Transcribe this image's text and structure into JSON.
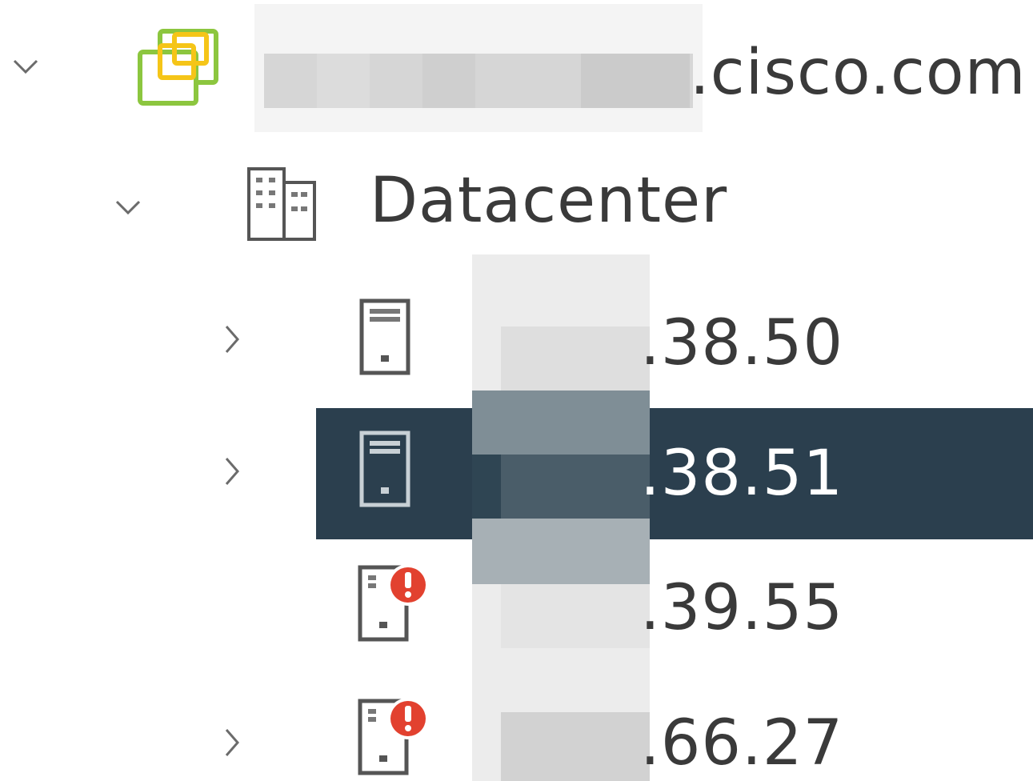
{
  "tree": {
    "vcenter": {
      "label": ".cisco.com",
      "expanded": true,
      "icon": "vcenter-icon",
      "icon_color": "#8cc63f",
      "icon_accent": "#f5c518"
    },
    "datacenter": {
      "label": "Datacenter",
      "expanded": true,
      "icon": "datacenter-icon"
    },
    "hosts": [
      {
        "label": ".38.50",
        "has_children": true,
        "selected": false,
        "alert": false,
        "icon": "host-icon"
      },
      {
        "label": ".38.51",
        "has_children": true,
        "selected": true,
        "alert": false,
        "icon": "host-icon"
      },
      {
        "label": ".39.55",
        "has_children": false,
        "selected": false,
        "alert": true,
        "icon": "host-alert-icon"
      },
      {
        "label": ".66.27",
        "has_children": true,
        "selected": false,
        "alert": true,
        "icon": "host-alert-icon"
      }
    ]
  },
  "colors": {
    "selected_bg": "#2b3f4e",
    "alert_red": "#e2412f",
    "text": "#3a3a3a",
    "selected_text": "#ffffff"
  }
}
